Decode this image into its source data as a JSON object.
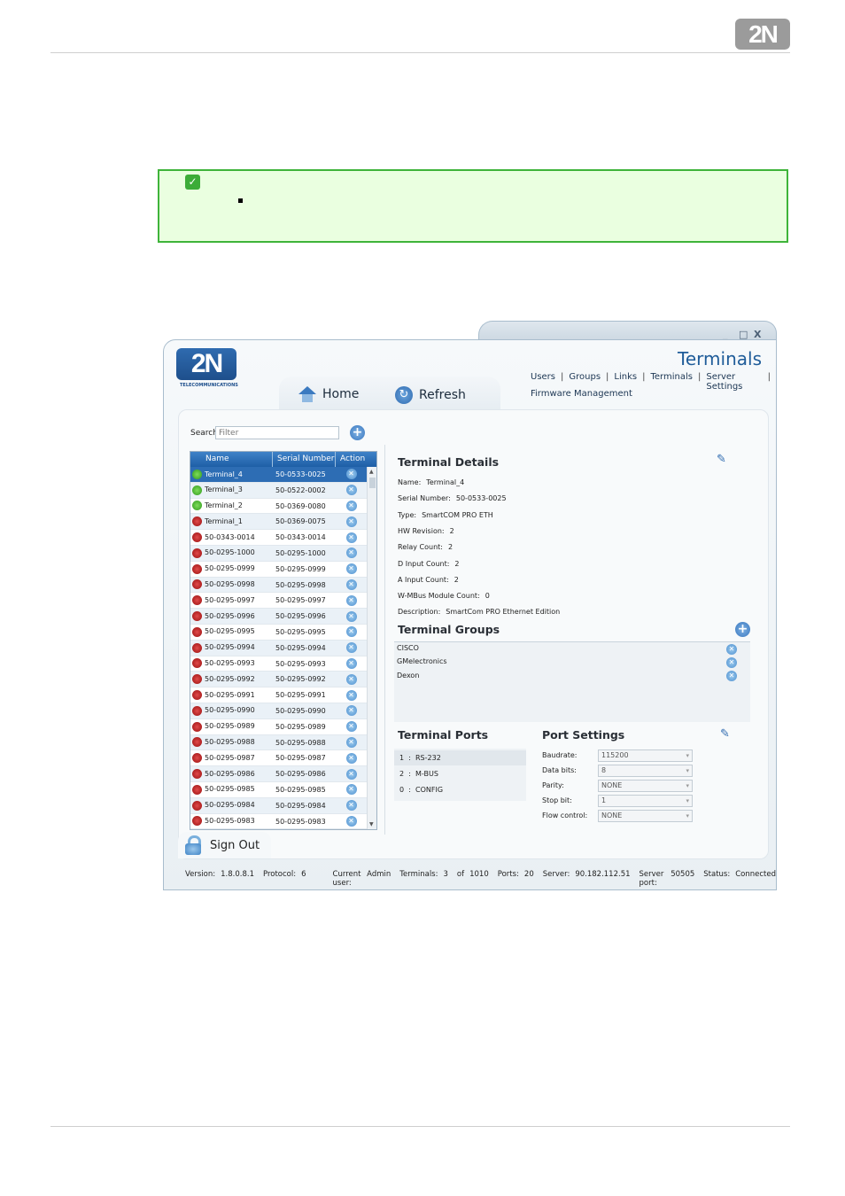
{
  "doc": {
    "logo": "2N"
  },
  "window": {
    "controls": {
      "minimize": "_",
      "maximize": "□",
      "close": "X"
    },
    "logo": "2N",
    "logo_sub": "TELECOMMUNICATIONS",
    "title": "Terminals"
  },
  "nav": {
    "users": "Users",
    "groups": "Groups",
    "links": "Links",
    "terminals": "Terminals",
    "server_settings": "Server Settings",
    "firmware": "Firmware Management",
    "sep": "|"
  },
  "tabs": {
    "home": "Home",
    "refresh": "Refresh"
  },
  "search": {
    "label": "Search",
    "placeholder": "Filter"
  },
  "table": {
    "headers": {
      "name": "Name",
      "serial": "Serial Number",
      "action": "Action"
    },
    "rows": [
      {
        "name": "Terminal_4",
        "serial": "50-0533-0025",
        "status": "green"
      },
      {
        "name": "Terminal_3",
        "serial": "50-0522-0002",
        "status": "green"
      },
      {
        "name": "Terminal_2",
        "serial": "50-0369-0080",
        "status": "green"
      },
      {
        "name": "Terminal_1",
        "serial": "50-0369-0075",
        "status": "red"
      },
      {
        "name": "50-0343-0014",
        "serial": "50-0343-0014",
        "status": "red"
      },
      {
        "name": "50-0295-1000",
        "serial": "50-0295-1000",
        "status": "red"
      },
      {
        "name": "50-0295-0999",
        "serial": "50-0295-0999",
        "status": "red"
      },
      {
        "name": "50-0295-0998",
        "serial": "50-0295-0998",
        "status": "red"
      },
      {
        "name": "50-0295-0997",
        "serial": "50-0295-0997",
        "status": "red"
      },
      {
        "name": "50-0295-0996",
        "serial": "50-0295-0996",
        "status": "red"
      },
      {
        "name": "50-0295-0995",
        "serial": "50-0295-0995",
        "status": "red"
      },
      {
        "name": "50-0295-0994",
        "serial": "50-0295-0994",
        "status": "red"
      },
      {
        "name": "50-0295-0993",
        "serial": "50-0295-0993",
        "status": "red"
      },
      {
        "name": "50-0295-0992",
        "serial": "50-0295-0992",
        "status": "red"
      },
      {
        "name": "50-0295-0991",
        "serial": "50-0295-0991",
        "status": "red"
      },
      {
        "name": "50-0295-0990",
        "serial": "50-0295-0990",
        "status": "red"
      },
      {
        "name": "50-0295-0989",
        "serial": "50-0295-0989",
        "status": "red"
      },
      {
        "name": "50-0295-0988",
        "serial": "50-0295-0988",
        "status": "red"
      },
      {
        "name": "50-0295-0987",
        "serial": "50-0295-0987",
        "status": "red"
      },
      {
        "name": "50-0295-0986",
        "serial": "50-0295-0986",
        "status": "red"
      },
      {
        "name": "50-0295-0985",
        "serial": "50-0295-0985",
        "status": "red"
      },
      {
        "name": "50-0295-0984",
        "serial": "50-0295-0984",
        "status": "red"
      },
      {
        "name": "50-0295-0983",
        "serial": "50-0295-0983",
        "status": "red"
      }
    ]
  },
  "details": {
    "heading": "Terminal Details",
    "fields": [
      {
        "label": "Name:",
        "value": "Terminal_4"
      },
      {
        "label": "Serial Number:",
        "value": "50-0533-0025"
      },
      {
        "label": "Type:",
        "value": "SmartCOM PRO ETH"
      },
      {
        "label": "HW Revision:",
        "value": "2"
      },
      {
        "label": "Relay Count:",
        "value": "2"
      },
      {
        "label": "D Input Count:",
        "value": "2"
      },
      {
        "label": "A Input Count:",
        "value": "2"
      },
      {
        "label": "W-MBus Module Count:",
        "value": "0"
      },
      {
        "label": "Description:",
        "value": "SmartCom PRO Ethernet Edition"
      }
    ]
  },
  "groups": {
    "heading": "Terminal Groups",
    "items": [
      "CISCO",
      "GMelectronics",
      "Dexon"
    ]
  },
  "ports": {
    "heading": "Terminal Ports",
    "items": [
      {
        "num": "1",
        "sep": ":",
        "name": "RS-232"
      },
      {
        "num": "2",
        "sep": ":",
        "name": "M-BUS"
      },
      {
        "num": "0",
        "sep": ":",
        "name": "CONFIG"
      }
    ]
  },
  "port_settings": {
    "heading": "Port Settings",
    "fields": [
      {
        "label": "Baudrate:",
        "value": "115200"
      },
      {
        "label": "Data bits:",
        "value": "8"
      },
      {
        "label": "Parity:",
        "value": "NONE"
      },
      {
        "label": "Stop bit:",
        "value": "1"
      },
      {
        "label": "Flow control:",
        "value": "NONE"
      }
    ]
  },
  "signout": "Sign Out",
  "status": {
    "version_label": "Version:",
    "version": "1.8.0.8.1",
    "protocol_label": "Protocol:",
    "protocol": "6",
    "user_label": "Current user:",
    "user": "Admin",
    "terminals_label": "Terminals:",
    "terminals": "3",
    "of": "of",
    "terminals_total": "1010",
    "ports_label": "Ports:",
    "ports": "20",
    "server_label": "Server:",
    "server": "90.182.112.51",
    "port_label": "Server port:",
    "port": "50505",
    "status_label": "Status:",
    "status": "Connected"
  }
}
